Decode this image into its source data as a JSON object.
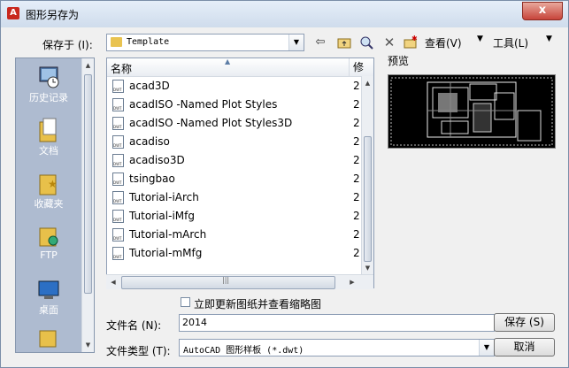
{
  "window": {
    "title": "图形另存为",
    "app_icon": "autocad-logo",
    "close_label": "x"
  },
  "location": {
    "label": "保存于 (I):",
    "value": "Template"
  },
  "toolbar": {
    "view_label": "查看(V)",
    "tools_label": "工具(L)"
  },
  "places": [
    {
      "label": "历史记录",
      "icon": "history-icon"
    },
    {
      "label": "文档",
      "icon": "documents-icon"
    },
    {
      "label": "收藏夹",
      "icon": "favorites-icon"
    },
    {
      "label": "FTP",
      "icon": "ftp-icon"
    },
    {
      "label": "桌面",
      "icon": "desktop-icon"
    }
  ],
  "filelist": {
    "columns": [
      "名称",
      "修"
    ],
    "files": [
      {
        "name": "acad3D",
        "date": "2"
      },
      {
        "name": "acadISO -Named Plot Styles",
        "date": "2"
      },
      {
        "name": "acadISO -Named Plot Styles3D",
        "date": "2"
      },
      {
        "name": "acadiso",
        "date": "2"
      },
      {
        "name": "acadiso3D",
        "date": "2"
      },
      {
        "name": "tsingbao",
        "date": "2"
      },
      {
        "name": "Tutorial-iArch",
        "date": "2"
      },
      {
        "name": "Tutorial-iMfg",
        "date": "2"
      },
      {
        "name": "Tutorial-mArch",
        "date": "2"
      },
      {
        "name": "Tutorial-mMfg",
        "date": "2"
      }
    ]
  },
  "preview": {
    "label": "预览"
  },
  "update_thumbnail": {
    "label": "立即更新图纸并查看缩略图",
    "checked": false
  },
  "filename": {
    "label": "文件名 (N):",
    "value": "2014"
  },
  "filetype": {
    "label": "文件类型 (T):",
    "value": "AutoCAD 图形样板 (*.dwt)"
  },
  "buttons": {
    "save": "保存 (S)",
    "cancel": "取消"
  }
}
